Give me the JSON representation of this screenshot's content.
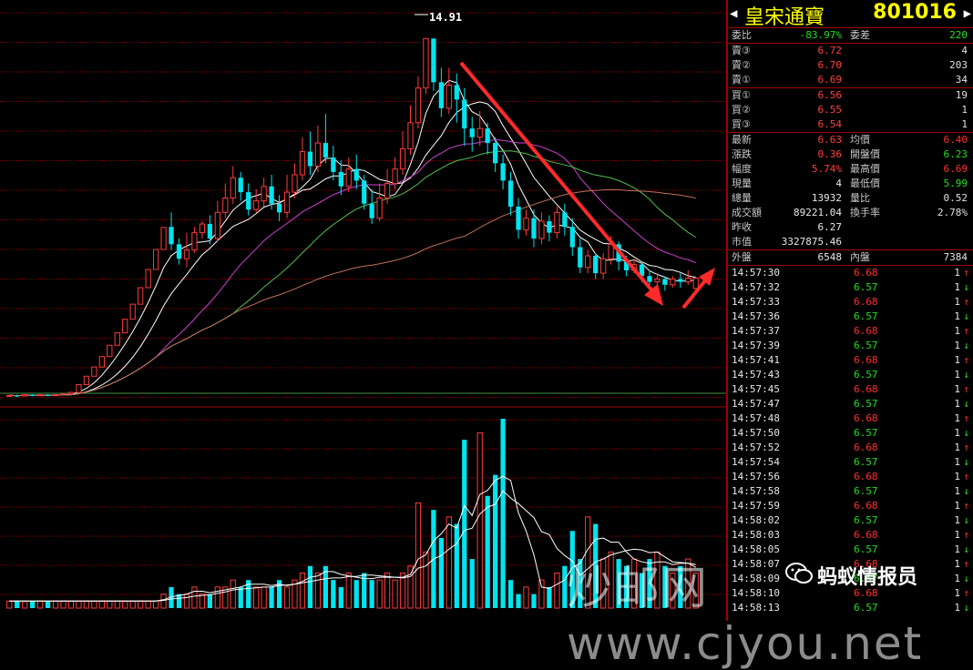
{
  "chart_data": {
    "type": "candlestick",
    "peak_label": "14.91",
    "candles": [
      [
        2.55,
        2.58,
        2.52,
        2.6
      ],
      [
        2.57,
        2.56,
        2.52,
        2.6
      ],
      [
        2.56,
        2.6,
        2.54,
        2.62
      ],
      [
        2.6,
        2.58,
        2.55,
        2.62
      ],
      [
        2.58,
        2.6,
        2.56,
        2.62
      ],
      [
        2.6,
        2.58,
        2.55,
        2.62
      ],
      [
        2.58,
        2.6,
        2.56,
        2.62
      ],
      [
        2.6,
        2.63,
        2.58,
        2.66
      ],
      [
        2.63,
        2.68,
        2.62,
        2.7
      ],
      [
        2.68,
        2.95,
        2.66,
        2.95
      ],
      [
        2.95,
        3.24,
        2.95,
        3.24
      ],
      [
        3.24,
        3.56,
        3.24,
        3.56
      ],
      [
        3.56,
        3.92,
        3.56,
        3.92
      ],
      [
        3.92,
        4.31,
        3.92,
        4.31
      ],
      [
        4.31,
        4.74,
        4.31,
        4.74
      ],
      [
        4.74,
        5.21,
        4.74,
        5.21
      ],
      [
        5.21,
        5.73,
        5.21,
        5.73
      ],
      [
        5.73,
        6.3,
        5.73,
        6.3
      ],
      [
        6.3,
        6.93,
        6.3,
        6.93
      ],
      [
        6.93,
        7.62,
        6.93,
        7.62
      ],
      [
        7.62,
        8.38,
        7.62,
        8.38
      ],
      [
        8.4,
        7.8,
        7.6,
        8.9
      ],
      [
        7.8,
        7.3,
        7.1,
        8.0
      ],
      [
        7.3,
        7.6,
        7.0,
        8.2
      ],
      [
        7.6,
        8.2,
        7.5,
        8.4
      ],
      [
        8.2,
        8.5,
        8.0,
        8.6
      ],
      [
        8.5,
        8.0,
        7.8,
        8.8
      ],
      [
        8.0,
        8.9,
        7.9,
        9.3
      ],
      [
        8.9,
        9.4,
        8.7,
        9.9
      ],
      [
        9.4,
        10.1,
        9.2,
        10.5
      ],
      [
        10.1,
        9.6,
        9.3,
        10.3
      ],
      [
        9.6,
        9.0,
        8.8,
        9.9
      ],
      [
        9.0,
        9.3,
        8.9,
        9.7
      ],
      [
        9.3,
        9.8,
        9.1,
        10.1
      ],
      [
        9.8,
        9.2,
        9.0,
        10.2
      ],
      [
        9.2,
        8.9,
        8.6,
        9.5
      ],
      [
        8.9,
        9.6,
        8.7,
        10.2
      ],
      [
        9.6,
        10.2,
        9.4,
        10.6
      ],
      [
        10.2,
        11.0,
        10.0,
        11.5
      ],
      [
        11.0,
        10.5,
        10.2,
        11.7
      ],
      [
        10.5,
        11.3,
        10.3,
        11.9
      ],
      [
        11.3,
        10.8,
        10.6,
        12.3
      ],
      [
        10.8,
        10.3,
        10.0,
        11.2
      ],
      [
        10.3,
        9.8,
        9.5,
        10.7
      ],
      [
        9.8,
        10.4,
        9.6,
        10.8
      ],
      [
        10.4,
        10.0,
        9.7,
        10.9
      ],
      [
        10.0,
        9.2,
        9.0,
        10.2
      ],
      [
        9.2,
        8.7,
        8.5,
        9.7
      ],
      [
        8.7,
        9.4,
        8.6,
        9.9
      ],
      [
        9.4,
        9.9,
        9.2,
        10.4
      ],
      [
        9.9,
        10.4,
        9.7,
        10.8
      ],
      [
        10.4,
        11.1,
        10.2,
        11.7
      ],
      [
        11.1,
        12.0,
        10.9,
        12.6
      ],
      [
        12.0,
        13.2,
        11.8,
        13.6
      ],
      [
        13.2,
        14.91,
        13.0,
        14.91
      ],
      [
        14.91,
        13.4,
        13.1,
        14.91
      ],
      [
        13.4,
        12.5,
        12.2,
        13.9
      ],
      [
        12.5,
        13.3,
        12.3,
        13.9
      ],
      [
        13.3,
        12.8,
        12.0,
        13.7
      ],
      [
        12.8,
        11.8,
        11.2,
        13.2
      ],
      [
        11.8,
        11.5,
        11.0,
        12.2
      ],
      [
        11.5,
        11.8,
        11.2,
        12.4
      ],
      [
        11.8,
        11.3,
        10.9,
        12.0
      ],
      [
        11.3,
        10.6,
        10.3,
        11.5
      ],
      [
        10.6,
        10.0,
        9.7,
        10.9
      ],
      [
        10.0,
        9.1,
        8.8,
        10.3
      ],
      [
        9.1,
        8.3,
        8.0,
        9.4
      ],
      [
        8.3,
        8.7,
        8.1,
        9.0
      ],
      [
        8.7,
        8.0,
        7.7,
        9.0
      ],
      [
        8.0,
        8.6,
        7.8,
        8.9
      ],
      [
        8.6,
        8.2,
        7.9,
        8.8
      ],
      [
        8.2,
        8.9,
        8.0,
        9.1
      ],
      [
        8.9,
        8.4,
        8.1,
        9.2
      ],
      [
        8.4,
        7.7,
        7.4,
        8.7
      ],
      [
        7.7,
        7.0,
        6.8,
        8.0
      ],
      [
        7.0,
        7.4,
        6.8,
        7.6
      ],
      [
        7.4,
        6.8,
        6.6,
        7.5
      ],
      [
        6.8,
        7.3,
        6.6,
        7.5
      ],
      [
        7.3,
        7.8,
        7.1,
        8.1
      ],
      [
        7.8,
        7.2,
        6.9,
        7.9
      ],
      [
        7.2,
        6.9,
        6.7,
        7.4
      ],
      [
        6.9,
        7.1,
        6.8,
        7.3
      ],
      [
        7.1,
        6.7,
        6.5,
        7.2
      ],
      [
        6.7,
        6.5,
        6.4,
        6.9
      ],
      [
        6.5,
        6.6,
        6.3,
        6.8
      ],
      [
        6.6,
        6.4,
        6.2,
        6.7
      ],
      [
        6.4,
        6.6,
        6.3,
        6.7
      ],
      [
        6.6,
        6.5,
        6.3,
        6.8
      ],
      [
        6.5,
        6.63,
        6.4,
        6.9
      ],
      [
        6.27,
        6.63,
        6.23,
        6.69
      ]
    ],
    "volume": [
      1,
      1,
      1,
      1,
      1,
      1,
      1,
      1,
      1,
      1,
      1,
      1,
      1,
      1,
      1,
      1,
      1,
      1,
      1,
      1,
      2,
      3,
      2,
      2,
      3,
      2,
      2,
      3,
      3,
      4,
      3,
      4,
      3,
      3,
      3,
      4,
      3,
      4,
      5,
      6,
      5,
      6,
      4,
      3,
      5,
      4,
      5,
      4,
      4,
      5,
      4,
      5,
      6,
      15,
      8,
      14,
      10,
      13,
      12,
      24,
      7,
      25,
      16,
      19,
      27,
      4,
      2,
      3,
      2,
      4,
      3,
      5,
      6,
      11,
      7,
      13,
      12,
      7,
      8,
      7,
      6,
      7,
      5,
      7,
      8,
      6,
      5,
      6,
      7,
      5
    ],
    "volume_colors_note": "",
    "ylim": [
      2.4,
      15.8
    ]
  },
  "header": {
    "name": "皇宋通寶",
    "code": "801016"
  },
  "quote": {
    "weibi_label": "委比",
    "weibi_value": "-83.97%",
    "weicha_label": "委差",
    "weicha_value": "220",
    "sells": [
      {
        "label": "賣③",
        "price": "6.72",
        "qty": "4"
      },
      {
        "label": "賣②",
        "price": "6.70",
        "qty": "203"
      },
      {
        "label": "賣①",
        "price": "6.69",
        "qty": "34"
      }
    ],
    "buys": [
      {
        "label": "買①",
        "price": "6.56",
        "qty": "19"
      },
      {
        "label": "買②",
        "price": "6.55",
        "qty": "1"
      },
      {
        "label": "買③",
        "price": "6.54",
        "qty": "1"
      }
    ],
    "stats": [
      {
        "l1": "最新",
        "v1": "6.63",
        "l2": "均價",
        "v2": "6.40"
      },
      {
        "l1": "漲跌",
        "v1": "0.36",
        "l2": "開盤價",
        "v2": "6.23"
      },
      {
        "l1": "幅度",
        "v1": "5.74%",
        "l2": "最高價",
        "v2": "6.69"
      },
      {
        "l1": "現量",
        "v1": "4",
        "l2": "最低價",
        "v2": "5.99"
      },
      {
        "l1": "總量",
        "v1": "13932",
        "l2": "量比",
        "v2": "0.52"
      },
      {
        "l1": "成交額",
        "v1": "89221.04",
        "l2": "換手率",
        "v2": "2.78%"
      },
      {
        "l1": "昨收",
        "v1": "6.27",
        "l2": "",
        "v2": ""
      },
      {
        "l1": "市值",
        "v1": "3327875.46",
        "l2": "",
        "v2": ""
      }
    ],
    "waipan_label": "外盤",
    "waipan_value": "6548",
    "neipan_label": "內盤",
    "neipan_value": "7384"
  },
  "ticks": [
    {
      "t": "14:57:30",
      "p": "6.68",
      "q": "1",
      "d": "up"
    },
    {
      "t": "14:57:32",
      "p": "6.57",
      "q": "1",
      "d": "down"
    },
    {
      "t": "14:57:33",
      "p": "6.68",
      "q": "1",
      "d": "up"
    },
    {
      "t": "14:57:36",
      "p": "6.57",
      "q": "1",
      "d": "down"
    },
    {
      "t": "14:57:37",
      "p": "6.68",
      "q": "1",
      "d": "up"
    },
    {
      "t": "14:57:39",
      "p": "6.57",
      "q": "1",
      "d": "down"
    },
    {
      "t": "14:57:41",
      "p": "6.68",
      "q": "1",
      "d": "up"
    },
    {
      "t": "14:57:43",
      "p": "6.57",
      "q": "1",
      "d": "down"
    },
    {
      "t": "14:57:45",
      "p": "6.68",
      "q": "1",
      "d": "up"
    },
    {
      "t": "14:57:47",
      "p": "6.57",
      "q": "1",
      "d": "down"
    },
    {
      "t": "14:57:48",
      "p": "6.68",
      "q": "1",
      "d": "up"
    },
    {
      "t": "14:57:50",
      "p": "6.57",
      "q": "1",
      "d": "down"
    },
    {
      "t": "14:57:52",
      "p": "6.68",
      "q": "1",
      "d": "up"
    },
    {
      "t": "14:57:54",
      "p": "6.57",
      "q": "1",
      "d": "down"
    },
    {
      "t": "14:57:56",
      "p": "6.68",
      "q": "1",
      "d": "up"
    },
    {
      "t": "14:57:58",
      "p": "6.57",
      "q": "1",
      "d": "down"
    },
    {
      "t": "14:57:59",
      "p": "6.68",
      "q": "1",
      "d": "up"
    },
    {
      "t": "14:58:02",
      "p": "6.57",
      "q": "1",
      "d": "down"
    },
    {
      "t": "14:58:03",
      "p": "6.68",
      "q": "1",
      "d": "up"
    },
    {
      "t": "14:58:05",
      "p": "6.57",
      "q": "1",
      "d": "down"
    },
    {
      "t": "14:58:07",
      "p": "6.68",
      "q": "1",
      "d": "up"
    },
    {
      "t": "14:58:09",
      "p": "6.57",
      "q": "1",
      "d": "down"
    },
    {
      "t": "14:58:10",
      "p": "6.68",
      "q": "1",
      "d": "up"
    },
    {
      "t": "14:58:13",
      "p": "6.57",
      "q": "1",
      "d": "down"
    }
  ],
  "watermark": {
    "site": "炒邮网 www.cjyou.net",
    "account": "蚂蚁情报员"
  },
  "colors": {
    "up": "#ff3b3b",
    "down": "#00e5f0",
    "grid": "#7a0000",
    "ma5": "#ffffff",
    "ma10": "#ffffff",
    "ma20": "#d040d0",
    "ma30": "#50c050",
    "ma60": "#c0705a",
    "arrow": "#ff2a2a"
  }
}
